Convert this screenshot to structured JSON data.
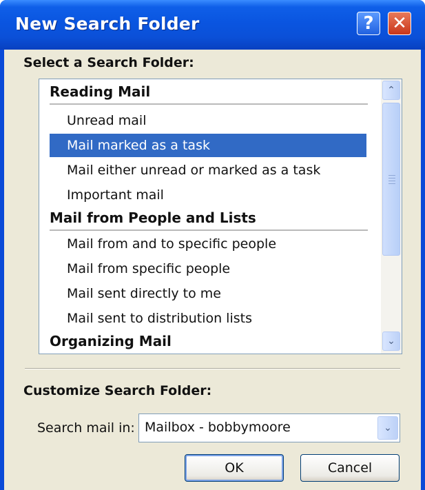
{
  "window": {
    "title": "New Search Folder",
    "help_glyph": "?",
    "close_glyph": "✕"
  },
  "select_heading": "Select a Search Folder:",
  "groups": [
    {
      "label": "Reading Mail"
    },
    {
      "label": "Mail from People and Lists"
    },
    {
      "label": "Organizing Mail"
    }
  ],
  "items": [
    {
      "label": "Unread mail",
      "selected": false
    },
    {
      "label": "Mail marked as a task",
      "selected": true
    },
    {
      "label": "Mail either unread or marked as a task",
      "selected": false
    },
    {
      "label": "Important mail",
      "selected": false
    },
    {
      "label": "Mail from and to specific people",
      "selected": false
    },
    {
      "label": "Mail from specific people",
      "selected": false
    },
    {
      "label": "Mail sent directly to me",
      "selected": false
    },
    {
      "label": "Mail sent to distribution lists",
      "selected": false
    }
  ],
  "scrollbar": {
    "up_glyph": "⌃",
    "down_glyph": "⌄"
  },
  "customize_heading": "Customize Search Folder:",
  "search_in": {
    "label": "Search mail in:",
    "value": "Mailbox - bobbymoore",
    "arrow_glyph": "⌄"
  },
  "buttons": {
    "ok": "OK",
    "cancel": "Cancel"
  },
  "colors": {
    "selection": "#316ac5",
    "titlebar": "#0a55e0",
    "dialog_bg": "#ece9d8"
  }
}
